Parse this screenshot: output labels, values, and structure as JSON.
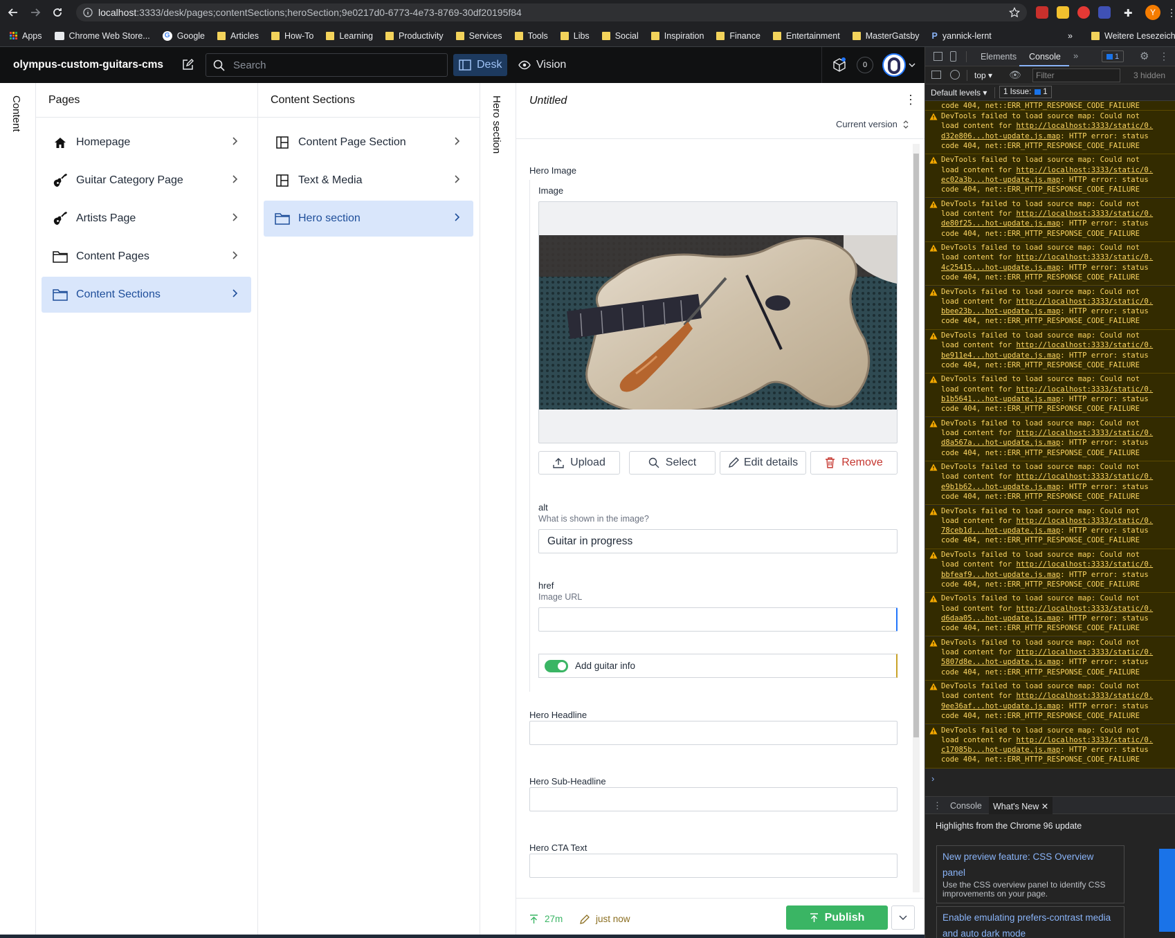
{
  "browser": {
    "url_host": "localhost",
    "url_rest": ":3333/desk/pages;contentSections;heroSection;9e0217d0-6773-4e73-8769-30df20195f84",
    "bookmarks": [
      "Apps",
      "Chrome Web Store...",
      "Google",
      "Articles",
      "How-To",
      "Learning",
      "Productivity",
      "Services",
      "Tools",
      "Libs",
      "Social",
      "Inspiration",
      "Finance",
      "Entertainment",
      "MasterGatsby",
      "yannick-lernt"
    ],
    "bookmarks_more": "Weitere Lesezeiche",
    "profile_initial": "Y"
  },
  "app": {
    "brand": "olympus-custom-guitars-cms",
    "search_placeholder": "Search",
    "tool_desk": "Desk",
    "tool_vision": "Vision",
    "notif_count": "0",
    "rail_label": "Content"
  },
  "pages_pane": {
    "title": "Pages",
    "items": [
      {
        "label": "Homepage",
        "icon": "home-icon"
      },
      {
        "label": "Guitar Category Page",
        "icon": "guitar-icon"
      },
      {
        "label": "Artists Page",
        "icon": "guitar-icon"
      },
      {
        "label": "Content Pages",
        "icon": "folder-icon"
      },
      {
        "label": "Content Sections",
        "icon": "folder-icon",
        "selected": true
      }
    ]
  },
  "sections_pane": {
    "title": "Content Sections",
    "items": [
      {
        "label": "Content Page Section",
        "icon": "layout-icon"
      },
      {
        "label": "Text & Media",
        "icon": "layout-icon"
      },
      {
        "label": "Hero section",
        "icon": "folder-icon",
        "selected": true
      }
    ],
    "collapsed_label": "Hero section"
  },
  "editor": {
    "title": "Untitled",
    "version": "Current version",
    "hero_image_label": "Hero Image",
    "image_label": "Image",
    "image_alt": "Guitar body being carved with a chisel",
    "btn_upload": "Upload",
    "btn_select": "Select",
    "btn_edit": "Edit details",
    "btn_remove": "Remove",
    "alt_label": "alt",
    "alt_desc": "What is shown in the image?",
    "alt_value": "Guitar in progress",
    "href_label": "href",
    "href_desc": "Image URL",
    "href_value": "",
    "toggle_label": "Add guitar info",
    "toggle_on": true,
    "headline_label": "Hero Headline",
    "subheadline_label": "Hero Sub-Headline",
    "cta_label": "Hero CTA Text",
    "footer_time": "27m",
    "footer_edited": "just now",
    "publish": "Publish"
  },
  "devtools": {
    "tabs": [
      "Elements",
      "Console"
    ],
    "active_tab": "Console",
    "issues_badge": "1",
    "context": "top",
    "filter_placeholder": "Filter",
    "hidden": "3 hidden",
    "levels": "Default levels",
    "issue_text": "1 Issue:",
    "issue_count": "1",
    "top_cut": "code 404, net::ERR_HTTP_RESPONSE_CODE_FAILURE",
    "messages": [
      {
        "hash": "d32e806"
      },
      {
        "hash": "ec02a3b"
      },
      {
        "hash": "de80f25"
      },
      {
        "hash": "4c25415"
      },
      {
        "hash": "bbee23b"
      },
      {
        "hash": "be911e4"
      },
      {
        "hash": "b1b5641"
      },
      {
        "hash": "d8a567a"
      },
      {
        "hash": "e9b1b62"
      },
      {
        "hash": "78ceb1d"
      },
      {
        "hash": "bbfeaf9"
      },
      {
        "hash": "d6daa05"
      },
      {
        "hash": "5807d8e"
      },
      {
        "hash": "9ee36af"
      },
      {
        "hash": "c17085b"
      }
    ],
    "msg_line1": "DevTools failed to load source map: Could not",
    "msg_line2a": "load content for ",
    "msg_link": "http://localhost:3333/static/0.",
    "msg_line3b": "...hot-update.js.map",
    "msg_line3c": ": HTTP error: status",
    "msg_line4": "code 404, net::ERR_HTTP_RESPONSE_CODE_FAILURE",
    "drawer_tabs": [
      "Console",
      "What's New"
    ],
    "whatsnew_heading": "Highlights from the Chrome 96 update",
    "card1_title": "New preview feature: CSS Overview panel",
    "card1_body": "Use the CSS overview panel to identify CSS improvements on your page.",
    "card2_title": "Enable emulating prefers-contrast media and auto dark mode"
  }
}
